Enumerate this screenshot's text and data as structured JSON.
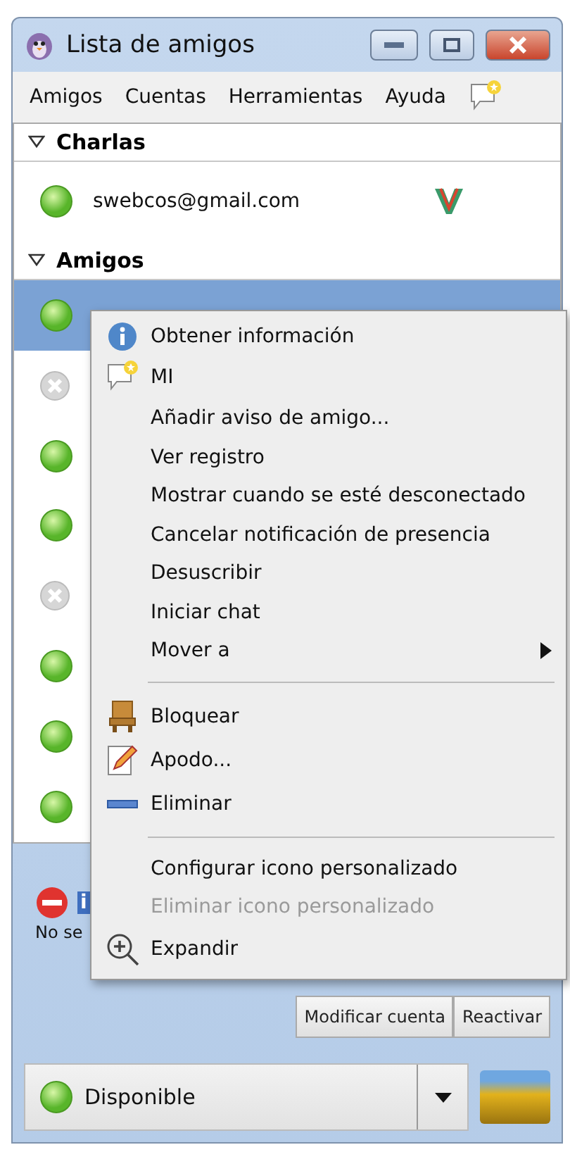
{
  "window": {
    "title": "Lista de amigos"
  },
  "menu_bar": [
    "Amigos",
    "Cuentas",
    "Herramientas",
    "Ayuda"
  ],
  "groups": [
    {
      "name": "Charlas",
      "expanded": true,
      "items": [
        {
          "name": "swebcos@gmail.com",
          "online": true,
          "selected": false
        }
      ]
    },
    {
      "name": "Amigos",
      "expanded": true,
      "items": [
        {
          "online": true,
          "selected": true
        },
        {
          "online": false,
          "selected": false
        },
        {
          "online": true,
          "selected": false
        },
        {
          "online": true,
          "selected": false
        },
        {
          "online": false,
          "selected": false
        },
        {
          "online": true,
          "selected": false
        },
        {
          "online": true,
          "selected": false
        },
        {
          "online": true,
          "selected": false
        }
      ]
    }
  ],
  "account_error": {
    "title": "i",
    "message": "No se"
  },
  "context_menu": [
    {
      "kind": "info",
      "label": "Obtener información",
      "disabled": false
    },
    {
      "kind": "im",
      "label": "MI",
      "disabled": false
    },
    {
      "kind": "plain",
      "label": "Añadir aviso de amigo...",
      "disabled": false
    },
    {
      "kind": "plain",
      "label": "Ver registro",
      "disabled": false
    },
    {
      "kind": "plain",
      "label": "Mostrar cuando se esté desconectado",
      "disabled": false
    },
    {
      "kind": "plain",
      "label": "Cancelar notificación de presencia",
      "disabled": false
    },
    {
      "kind": "plain",
      "label": "Desuscribir",
      "disabled": false
    },
    {
      "kind": "plain",
      "label": "Iniciar chat",
      "disabled": false
    },
    {
      "kind": "submenu",
      "label": "Mover a",
      "disabled": false
    },
    {
      "kind": "separator"
    },
    {
      "kind": "block",
      "label": "Bloquear",
      "disabled": false
    },
    {
      "kind": "edit",
      "label": "Apodo...",
      "disabled": false
    },
    {
      "kind": "remove",
      "label": "Eliminar",
      "disabled": false
    },
    {
      "kind": "separator"
    },
    {
      "kind": "plain",
      "label": "Configurar icono personalizado",
      "disabled": false
    },
    {
      "kind": "plain",
      "label": "Eliminar icono personalizado",
      "disabled": true
    },
    {
      "kind": "zoom",
      "label": "Expandir",
      "disabled": false
    }
  ],
  "account_buttons": [
    "Modificar cuenta",
    "Reactivar"
  ],
  "status_selector": {
    "value": "Disponible",
    "online": true
  }
}
